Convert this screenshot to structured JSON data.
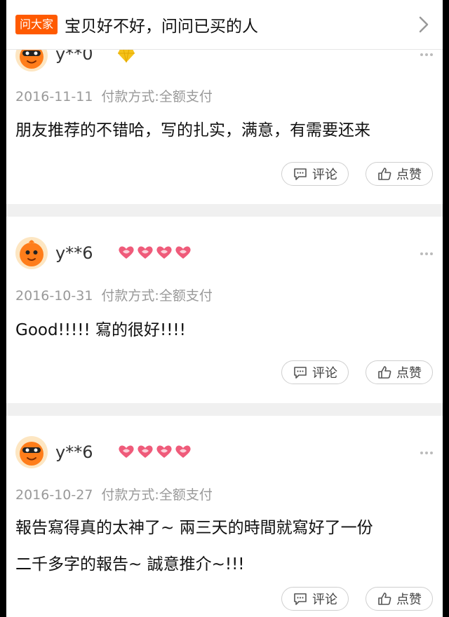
{
  "ask": {
    "badge": "问大家",
    "prompt": "宝贝好不好，问问已买的人"
  },
  "actions": {
    "comment_label": "评论",
    "like_label": "点赞"
  },
  "reviews": [
    {
      "user": "y**0",
      "level_badge": "diamond",
      "date": "2016-11-11",
      "payment": "付款方式:全额支付",
      "lines": [
        "朋友推荐的不错哈，写的扎实，满意，有需要还来"
      ]
    },
    {
      "user": "y**6",
      "level_badge": "4 hearts",
      "date": "2016-10-31",
      "payment": "付款方式:全额支付",
      "lines": [
        "Good!!!!! 寫的很好!!!!"
      ]
    },
    {
      "user": "y**6",
      "level_badge": "4 hearts",
      "date": "2016-10-27",
      "payment": "付款方式:全额支付",
      "lines": [
        "報告寫得真的太神了~ 兩三天的時間就寫好了一份",
        "二千多字的報告~ 誠意推介~!!!"
      ]
    }
  ],
  "colors": {
    "accent": "#ff5a00",
    "heart": "#ef5b7a",
    "diamond": "#f5c21b"
  }
}
